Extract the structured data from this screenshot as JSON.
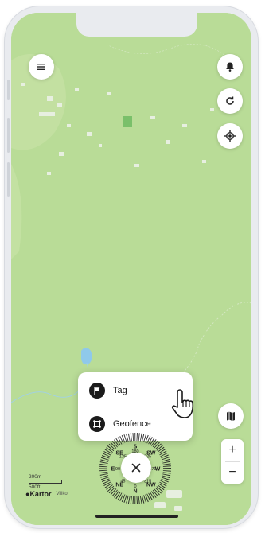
{
  "menu": {
    "items": [
      {
        "label": "Tag",
        "icon": "flag-icon"
      },
      {
        "label": "Geofence",
        "icon": "polygon-icon"
      }
    ]
  },
  "toolbar": {
    "menu_icon": "hamburger-icon",
    "notifications_icon": "bell-icon",
    "refresh_icon": "refresh-icon",
    "location_icon": "crosshair-icon",
    "map_layers_icon": "map-icon"
  },
  "zoom": {
    "in_label": "+",
    "out_label": "−"
  },
  "scale": {
    "metric": "200m",
    "imperial": "500ft"
  },
  "attribution": {
    "brand": "Kartor",
    "legal": "Villkor"
  },
  "compass": {
    "labels": [
      "NE",
      "E",
      "SE",
      "S",
      "SW",
      "W",
      "NW",
      "N"
    ],
    "degrees": [
      "45",
      "90",
      "135",
      "180",
      "225",
      "270",
      "315",
      "0"
    ]
  },
  "colors": {
    "map_land": "#b9dc97",
    "water": "#8fc9ea",
    "card": "#ffffff",
    "icon_dark": "#1b1b1b"
  }
}
